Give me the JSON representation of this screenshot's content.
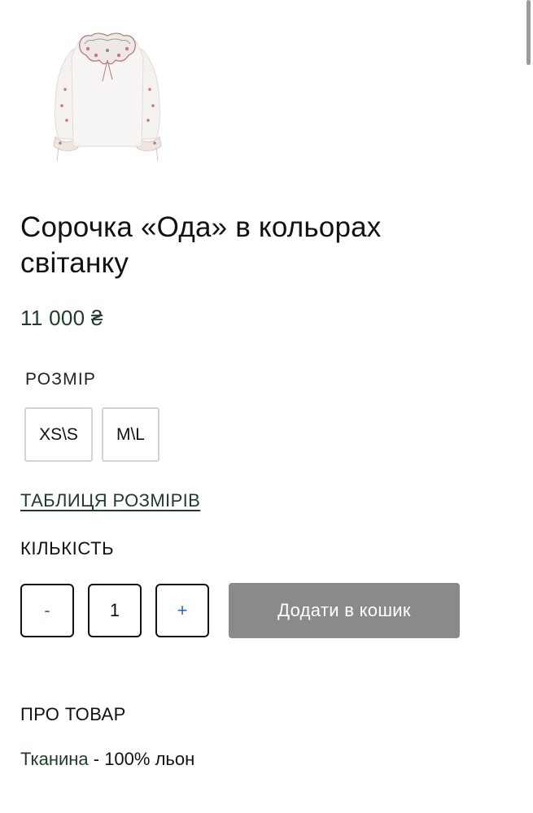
{
  "product": {
    "image_alt": "Сорочка «Ода» в кольорах світанку",
    "title": "Сорочка «Ода» в кольорах світанку",
    "price": "11 000 ₴"
  },
  "size": {
    "label": "РОЗМІР",
    "options": [
      "XS\\S",
      "M\\L"
    ],
    "table_link": "ТАБЛИЦЯ РОЗМІРІВ"
  },
  "quantity": {
    "label": "КІЛЬКІСТЬ",
    "minus": "-",
    "value": "1",
    "plus": "+"
  },
  "cart": {
    "add_label": "Додати в кошик"
  },
  "about": {
    "title": "ПРО ТОВАР",
    "fabric_key": "Тканина",
    "fabric_value": " - 100% льон"
  },
  "colors": {
    "accent_green": "#1f3b2a",
    "button_grey": "#8a8a8a",
    "stepper_blue": "#2b6cb0"
  }
}
